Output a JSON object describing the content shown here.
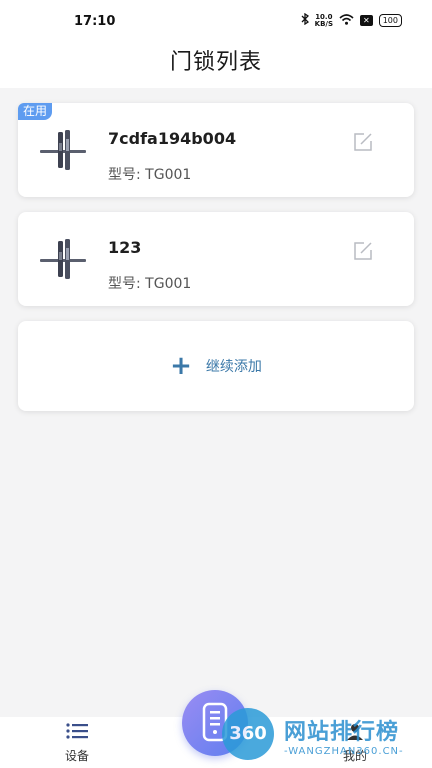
{
  "status_bar": {
    "time": "17:10",
    "net_speed_value": "10.0",
    "net_speed_unit": "KB/S",
    "battery": "100",
    "x_badge": "✕"
  },
  "header": {
    "title": "门锁列表"
  },
  "devices": [
    {
      "badge": "在用",
      "name": "7cdfa194b004",
      "model": "型号: TG001"
    },
    {
      "badge": "",
      "name": "123",
      "model": "型号: TG001"
    }
  ],
  "add": {
    "label": "继续添加",
    "icon": "plus-icon"
  },
  "tabbar": {
    "tabs": [
      {
        "label": "设备",
        "icon": "list-icon"
      },
      {
        "label": "我的",
        "icon": "person-icon"
      }
    ]
  },
  "watermark": {
    "badge": "360",
    "text": "网站排行榜",
    "url": "-WANGZHAN360.CN-"
  },
  "colors": {
    "accent": "#3b78a8",
    "badge": "#5e9cf0",
    "center_button": "#7b85f1"
  }
}
